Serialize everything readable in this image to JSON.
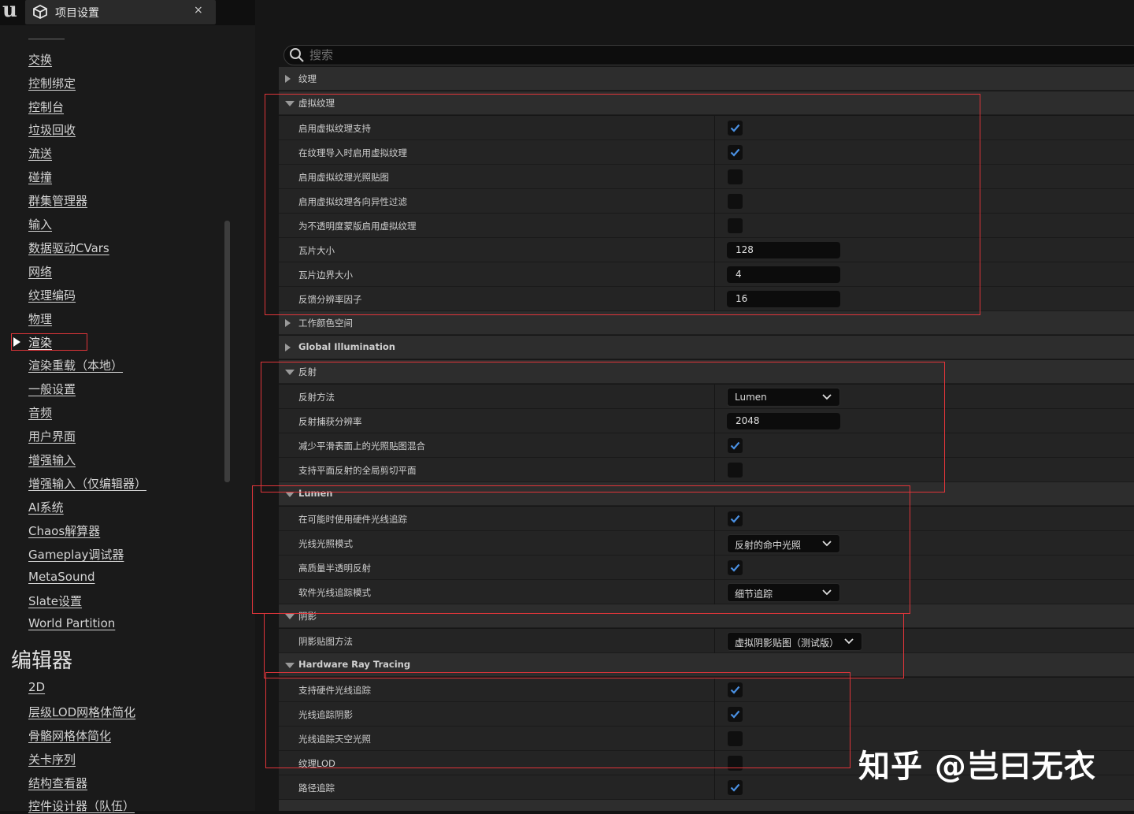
{
  "tab": {
    "title": "项目设置",
    "close": "×"
  },
  "sidebar": {
    "items": [
      "交换",
      "控制绑定",
      "控制台",
      "垃圾回收",
      "流送",
      "碰撞",
      "群集管理器",
      "输入",
      "数据驱动CVars",
      "网络",
      "纹理编码",
      "物理",
      "渲染",
      "渲染重载（本地）",
      "一般设置",
      "音频",
      "用户界面",
      "增强输入",
      "增强输入（仅编辑器）",
      "AI系统",
      "Chaos解算器",
      "Gameplay调试器",
      "MetaSound",
      "Slate设置",
      "World Partition"
    ],
    "selected": "渲染",
    "editor_heading": "编辑器",
    "editor_items": [
      "2D",
      "层级LOD网格体简化",
      "骨骼网格体简化",
      "关卡序列",
      "结构查看器",
      "控件设计器（队伍）"
    ]
  },
  "search": {
    "placeholder": "搜索"
  },
  "sections": {
    "texture": "纹理",
    "virtual_texture": "虚拟纹理",
    "working_color_space": "工作颜色空间",
    "global_illumination": "Global Illumination",
    "reflection": "反射",
    "lumen": "Lumen",
    "shadows": "阴影",
    "hardware_ray_tracing": "Hardware Ray Tracing"
  },
  "vt": {
    "enable_support": {
      "label": "启用虚拟纹理支持",
      "checked": true
    },
    "enable_on_import": {
      "label": "在纹理导入时启用虚拟纹理",
      "checked": true
    },
    "enable_lightmaps": {
      "label": "启用虚拟纹理光照贴图",
      "checked": false
    },
    "enable_aniso": {
      "label": "启用虚拟纹理各向异性过滤",
      "checked": false
    },
    "enable_opacity_mask": {
      "label": "为不透明度蒙版启用虚拟纹理",
      "checked": false
    },
    "tile_size": {
      "label": "瓦片大小",
      "value": "128"
    },
    "tile_border": {
      "label": "瓦片边界大小",
      "value": "4"
    },
    "feedback_factor": {
      "label": "反馈分辨率因子",
      "value": "16"
    }
  },
  "refl": {
    "method": {
      "label": "反射方法",
      "value": "Lumen"
    },
    "capture_res": {
      "label": "反射捕获分辨率",
      "value": "2048"
    },
    "reduce_lightmap_mix": {
      "label": "减少平滑表面上的光照贴图混合",
      "checked": true
    },
    "global_clip_plane": {
      "label": "支持平面反射的全局剪切平面",
      "checked": false
    }
  },
  "lumen": {
    "use_hw_rt": {
      "label": "在可能时使用硬件光线追踪",
      "checked": true
    },
    "lighting_mode": {
      "label": "光线光照模式",
      "value": "反射的命中光照"
    },
    "hq_translucency": {
      "label": "高质量半透明反射",
      "checked": true
    },
    "sw_rt_mode": {
      "label": "软件光线追踪模式",
      "value": "细节追踪"
    }
  },
  "shadows": {
    "map_method": {
      "label": "阴影贴图方法",
      "value": "虚拟阴影贴图（测试版）"
    }
  },
  "hwrt": {
    "support": {
      "label": "支持硬件光线追踪",
      "checked": true
    },
    "shadows": {
      "label": "光线追踪阴影",
      "checked": true
    },
    "skylight": {
      "label": "光线追踪天空光照",
      "checked": false
    },
    "texture_lod": {
      "label": "纹理LOD",
      "checked": false
    },
    "path_tracing": {
      "label": "路径追踪",
      "checked": true
    }
  },
  "watermark": "知乎 @岂曰无衣",
  "colors": {
    "highlight_box": "#e0353a",
    "check": "#4a90e2"
  }
}
